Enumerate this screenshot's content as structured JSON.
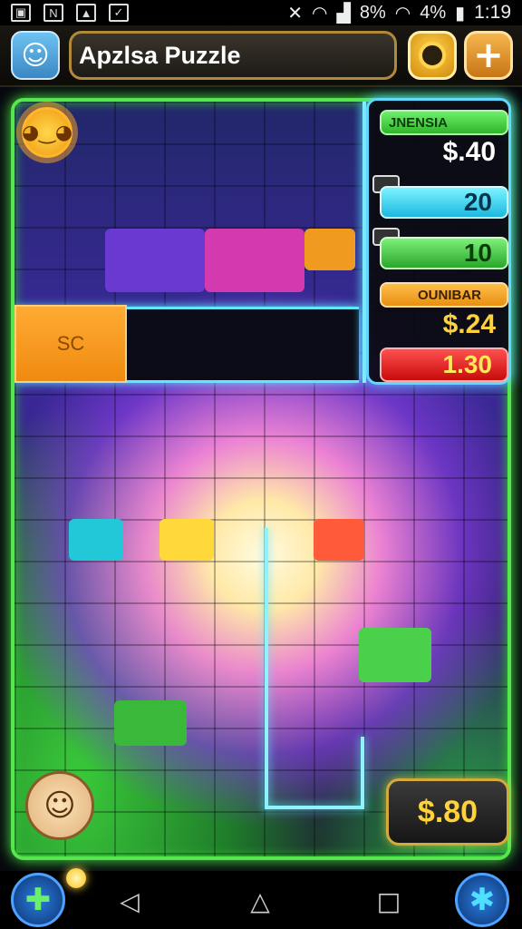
{
  "status_bar": {
    "battery": "4%",
    "signal": "8%",
    "time": "1:19"
  },
  "header": {
    "title": "Apzlsa Puzzle",
    "settings_icon": "gear-icon",
    "add_icon": "plus-icon",
    "add_label": "+"
  },
  "board": {
    "orange_piece_label": "SC",
    "sun_icon": "sun-icon",
    "face_icon": "character-face-icon"
  },
  "panel": {
    "header1": "JNENSIA",
    "value1": "$.40",
    "cyan_value": "20",
    "green_value": "10",
    "header2": "OUNIBAR",
    "value2": "$.24",
    "red_value": "1.30"
  },
  "score_button": {
    "label": "$.80"
  },
  "navbar": {
    "back_glyph": "◁",
    "home_glyph": "△",
    "recents_glyph": "□"
  },
  "colors": {
    "board_border": "#56e64e",
    "panel_border": "#61d8ff",
    "accent_gold": "#ffd23a"
  }
}
